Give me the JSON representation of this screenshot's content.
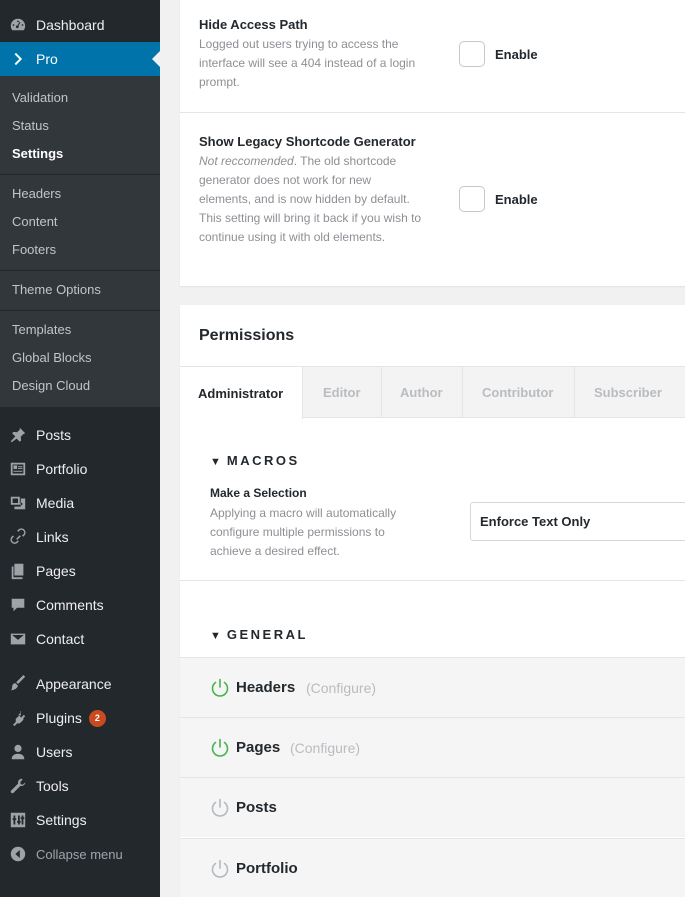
{
  "sidebar": {
    "top": [
      {
        "id": "dashboard",
        "label": "Dashboard",
        "icon": "dashboard-icon"
      },
      {
        "id": "pro",
        "label": "Pro",
        "icon": "chevron-right-icon"
      }
    ],
    "pro_sub": [
      "Validation",
      "Status",
      "Settings",
      "Headers",
      "Content",
      "Footers",
      "Theme Options",
      "Templates",
      "Global Blocks",
      "Design Cloud"
    ],
    "menu": [
      {
        "id": "posts",
        "label": "Posts",
        "icon": "pushpin-icon"
      },
      {
        "id": "portfolio",
        "label": "Portfolio",
        "icon": "portfolio-icon"
      },
      {
        "id": "media",
        "label": "Media",
        "icon": "media-icon"
      },
      {
        "id": "links",
        "label": "Links",
        "icon": "link-icon"
      },
      {
        "id": "pages",
        "label": "Pages",
        "icon": "pages-icon"
      },
      {
        "id": "comments",
        "label": "Comments",
        "icon": "comment-icon"
      },
      {
        "id": "contact",
        "label": "Contact",
        "icon": "envelope-icon"
      },
      {
        "id": "appearance",
        "label": "Appearance",
        "icon": "paintbrush-icon"
      },
      {
        "id": "plugins",
        "label": "Plugins",
        "icon": "plugin-icon",
        "badge": "2"
      },
      {
        "id": "users",
        "label": "Users",
        "icon": "user-icon"
      },
      {
        "id": "tools",
        "label": "Tools",
        "icon": "wrench-icon"
      },
      {
        "id": "settings",
        "label": "Settings",
        "icon": "settings-sliders-icon"
      }
    ],
    "collapse_label": "Collapse menu"
  },
  "settings": {
    "hide_access": {
      "title": "Hide Access Path",
      "desc": "Logged out users trying to access the interface will see a 404 instead of a login prompt.",
      "checkbox_label": "Enable"
    },
    "legacy": {
      "title": "Show Legacy Shortcode Generator",
      "desc_em": "Not reccomended",
      "desc_rest": ". The old shortcode generator does not work for new elements, and is now hidden by default. This setting will bring it back if you wish to continue using it with old elements.",
      "checkbox_label": "Enable"
    }
  },
  "permissions": {
    "title": "Permissions",
    "tabs": [
      "Administrator",
      "Editor",
      "Author",
      "Contributor",
      "Subscriber"
    ],
    "macros": {
      "heading": "MACROS",
      "select_title": "Make a Selection",
      "select_desc": "Applying a macro will automatically configure multiple permissions to achieve a desired effect.",
      "selected_value": "Enforce Text Only"
    },
    "general": {
      "heading": "GENERAL",
      "rows": [
        {
          "name": "Headers",
          "configure": "(Configure)",
          "enabled": true
        },
        {
          "name": "Pages",
          "configure": "(Configure)",
          "enabled": true
        },
        {
          "name": "Posts",
          "configure": "",
          "enabled": false
        },
        {
          "name": "Portfolio",
          "configure": "",
          "enabled": false
        }
      ]
    }
  },
  "colors": {
    "sidebar_bg": "#23282d",
    "accent": "#0073aa",
    "power_on": "#46b450",
    "power_off": "#b4b9be"
  }
}
